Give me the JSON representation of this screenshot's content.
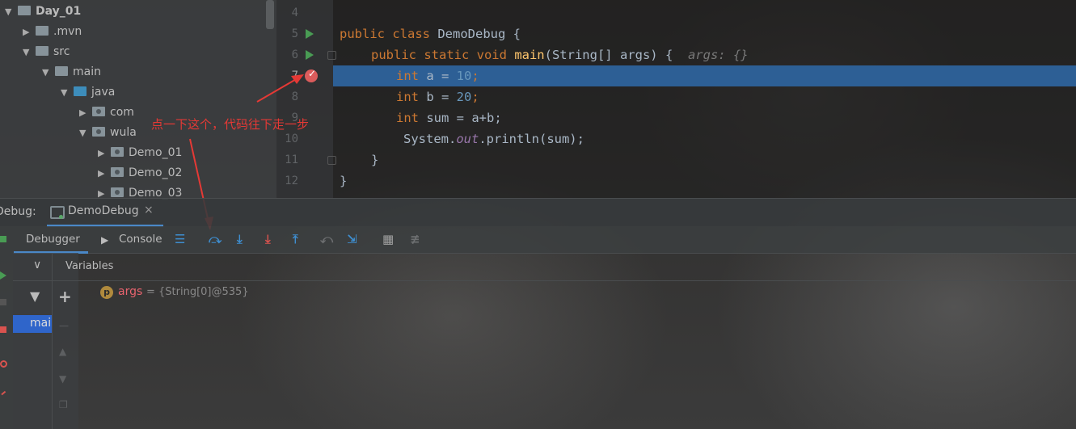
{
  "project_tree": {
    "items": [
      {
        "label": "Day_01",
        "bold": true
      },
      {
        "label": ".mvn"
      },
      {
        "label": "src"
      },
      {
        "label": "main"
      },
      {
        "label": "java"
      },
      {
        "label": "com"
      },
      {
        "label": "wula"
      },
      {
        "label": "Demo_01"
      },
      {
        "label": "Demo_02"
      },
      {
        "label": "Demo_03"
      }
    ]
  },
  "editor": {
    "line_numbers": [
      "4",
      "5",
      "6",
      "7",
      "8",
      "9",
      "10",
      "11",
      "12"
    ],
    "code": {
      "l5_kw": "public class ",
      "l5_name": "DemoDebug {",
      "l6_kw": "public static void ",
      "l6_fn": "main",
      "l6_rest": "(String[] args) {",
      "l6_hint": "args: {}",
      "l7_kw": "int",
      "l7_mid": " a = ",
      "l7_num": "10",
      "l7_end": ";",
      "l8_kw": "int",
      "l8_mid": " b = ",
      "l8_num": "20",
      "l8_end": ";",
      "l9_kw": "int",
      "l9_rest": " sum = a+b;",
      "l10_a": "System.",
      "l10_out": "out",
      "l10_b": ".println(sum);",
      "l11": "}",
      "l12": "}"
    },
    "highlight_color": "#2d5f95",
    "breakpoint_color": "#db5c5c"
  },
  "annotation": {
    "note": "点一下这个，代码往下走一步",
    "color": "#e53935"
  },
  "debug": {
    "label": "Debug:",
    "session_tab": "DemoDebug",
    "session_close": "×",
    "tabs": {
      "debugger": "Debugger",
      "console": "Console"
    },
    "frames_selected": "mai",
    "variables_title": "Variables",
    "variable": {
      "icon": "p",
      "name": "args",
      "value": "= {String[0]@535}"
    }
  }
}
